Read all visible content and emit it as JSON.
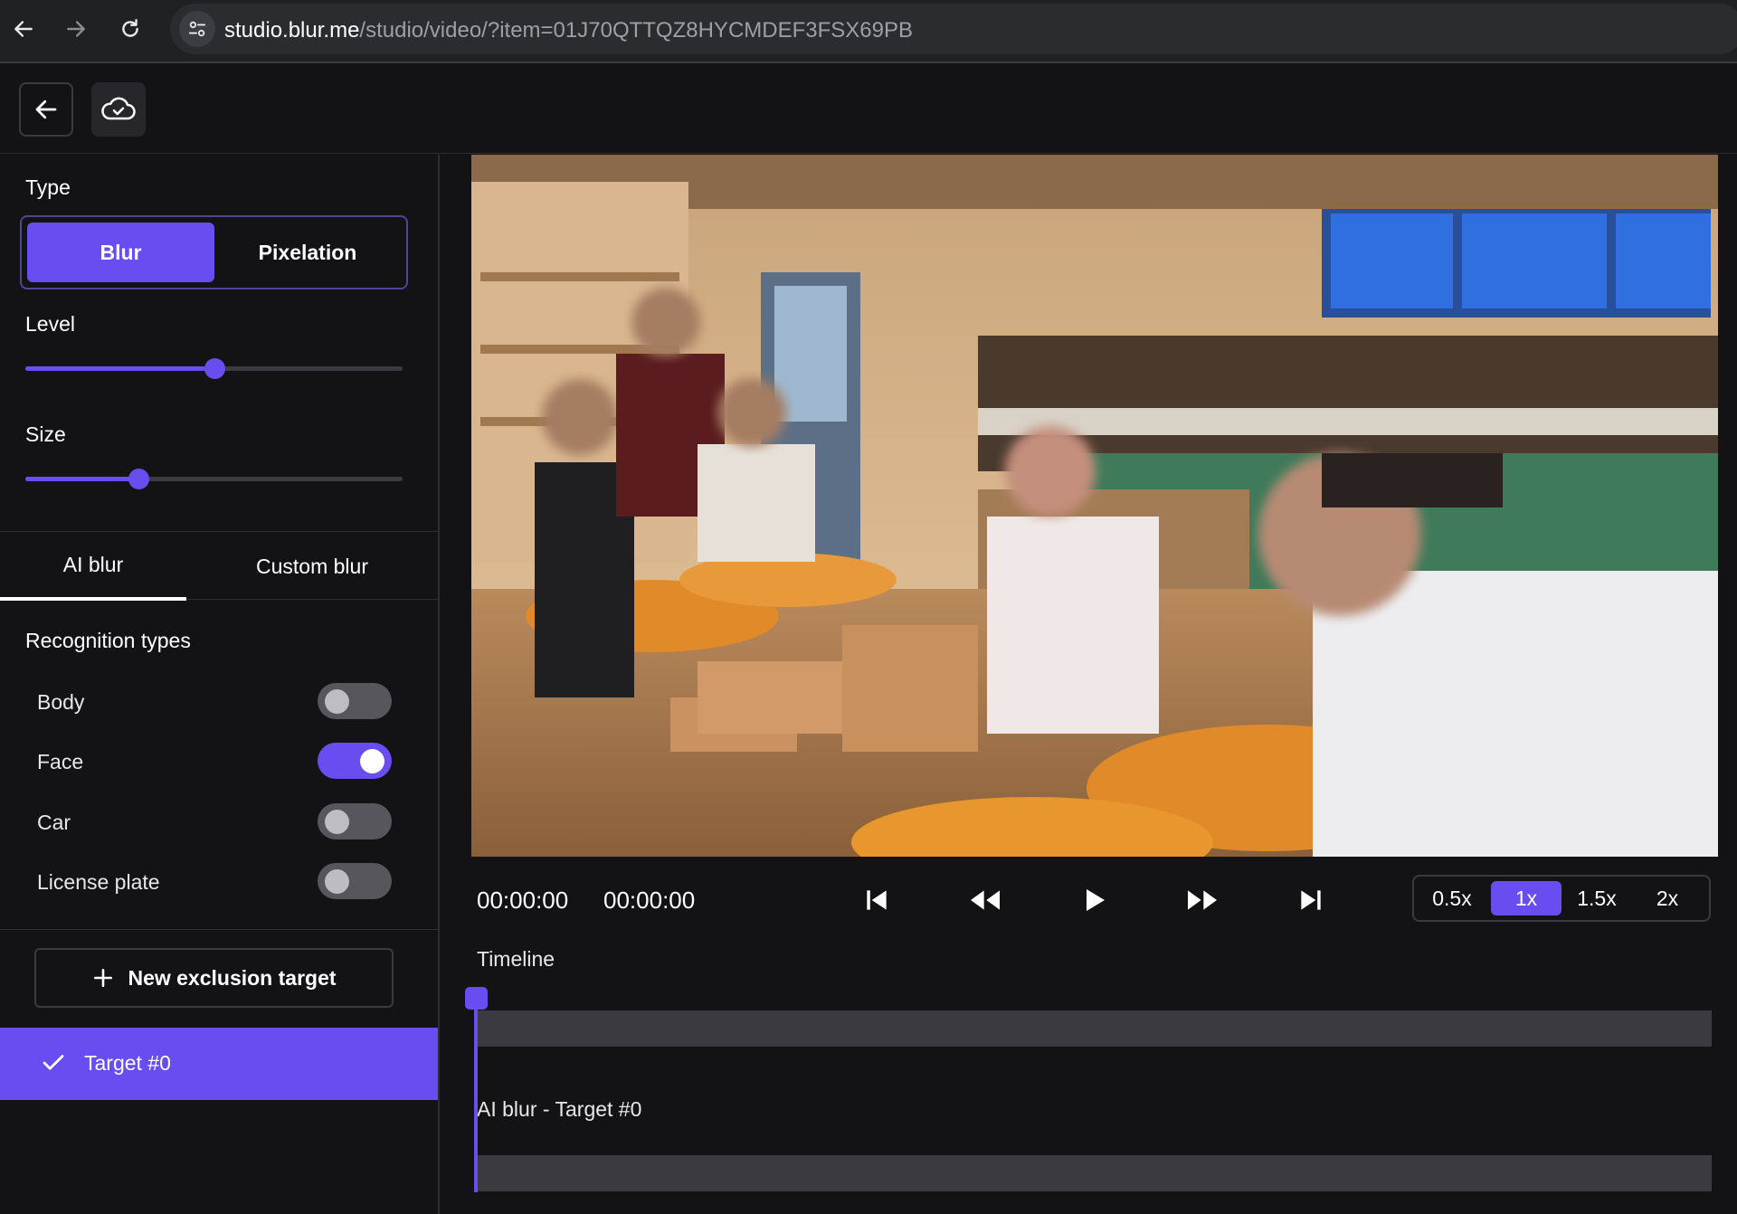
{
  "browser": {
    "url_host": "studio.blur.me",
    "url_path": "/studio/video/?item=01J70QTTQZ8HYCMDEF3FSX69PB"
  },
  "sidebar": {
    "type_label": "Type",
    "type_options": [
      "Blur",
      "Pixelation"
    ],
    "type_selected": "Blur",
    "level_label": "Level",
    "level_value": 0.5,
    "size_label": "Size",
    "size_value": 0.3,
    "tabs": [
      "AI blur",
      "Custom blur"
    ],
    "active_tab": "AI blur",
    "recognition_title": "Recognition types",
    "recognition_types": [
      {
        "label": "Body",
        "enabled": false
      },
      {
        "label": "Face",
        "enabled": true
      },
      {
        "label": "Car",
        "enabled": false
      },
      {
        "label": "License plate",
        "enabled": false
      }
    ],
    "new_exclusion_label": "New exclusion target",
    "target_label": "Target #0"
  },
  "player": {
    "current_time": "00:00:00",
    "duration": "00:00:00",
    "speeds": [
      "0.5x",
      "1x",
      "1.5x",
      "2x"
    ],
    "active_speed": "1x",
    "icons": [
      "skip-start-icon",
      "rewind-icon",
      "play-icon",
      "fast-forward-icon",
      "skip-end-icon"
    ]
  },
  "timeline": {
    "label": "Timeline",
    "track_label": "AI blur - Target #0"
  },
  "colors": {
    "accent": "#6a4df0",
    "background": "#131316",
    "track": "#3a3a40"
  }
}
